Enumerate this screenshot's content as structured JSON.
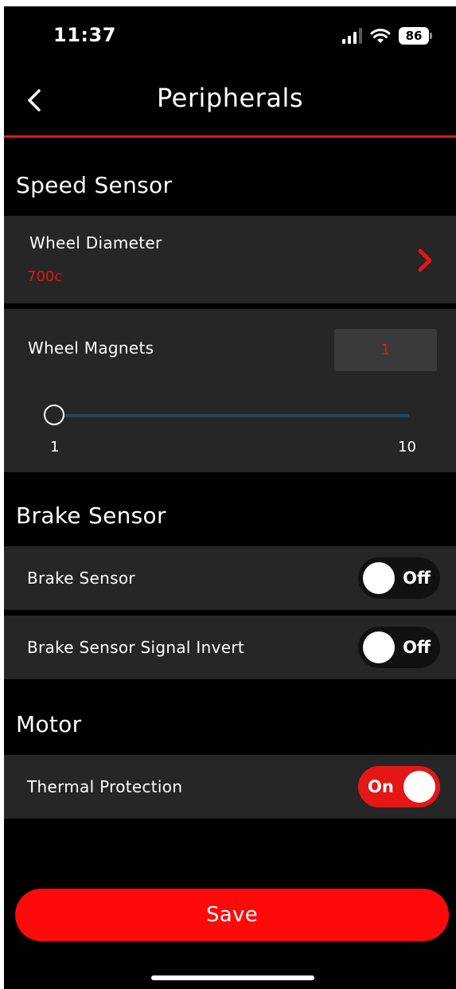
{
  "status_bar": {
    "time": "11:37",
    "battery": "86"
  },
  "header": {
    "title": "Peripherals"
  },
  "speed_sensor": {
    "title": "Speed Sensor",
    "wheel_diameter": {
      "label": "Wheel Diameter",
      "value": "700c"
    },
    "wheel_magnets": {
      "label": "Wheel Magnets",
      "value": "1",
      "slider_min": "1",
      "slider_max": "10",
      "slider_level": 1
    }
  },
  "brake_sensor": {
    "title": "Brake Sensor",
    "brake_sensor": {
      "label": "Brake Sensor",
      "state": "Off"
    },
    "signal_invert": {
      "label": "Brake Sensor Signal Invert",
      "state": "Off"
    }
  },
  "motor": {
    "title": "Motor",
    "thermal_protection": {
      "label": "Thermal Protection",
      "state": "On"
    }
  },
  "actions": {
    "save_label": "Save"
  },
  "colors": {
    "accent": "#e51616",
    "row_bg": "#262626",
    "save_bg": "#ff0a0a",
    "slider_track": "#2a4560"
  },
  "icons": {
    "back": "chevron-left-icon",
    "wheel_diameter_arrow": "chevron-right-icon"
  }
}
